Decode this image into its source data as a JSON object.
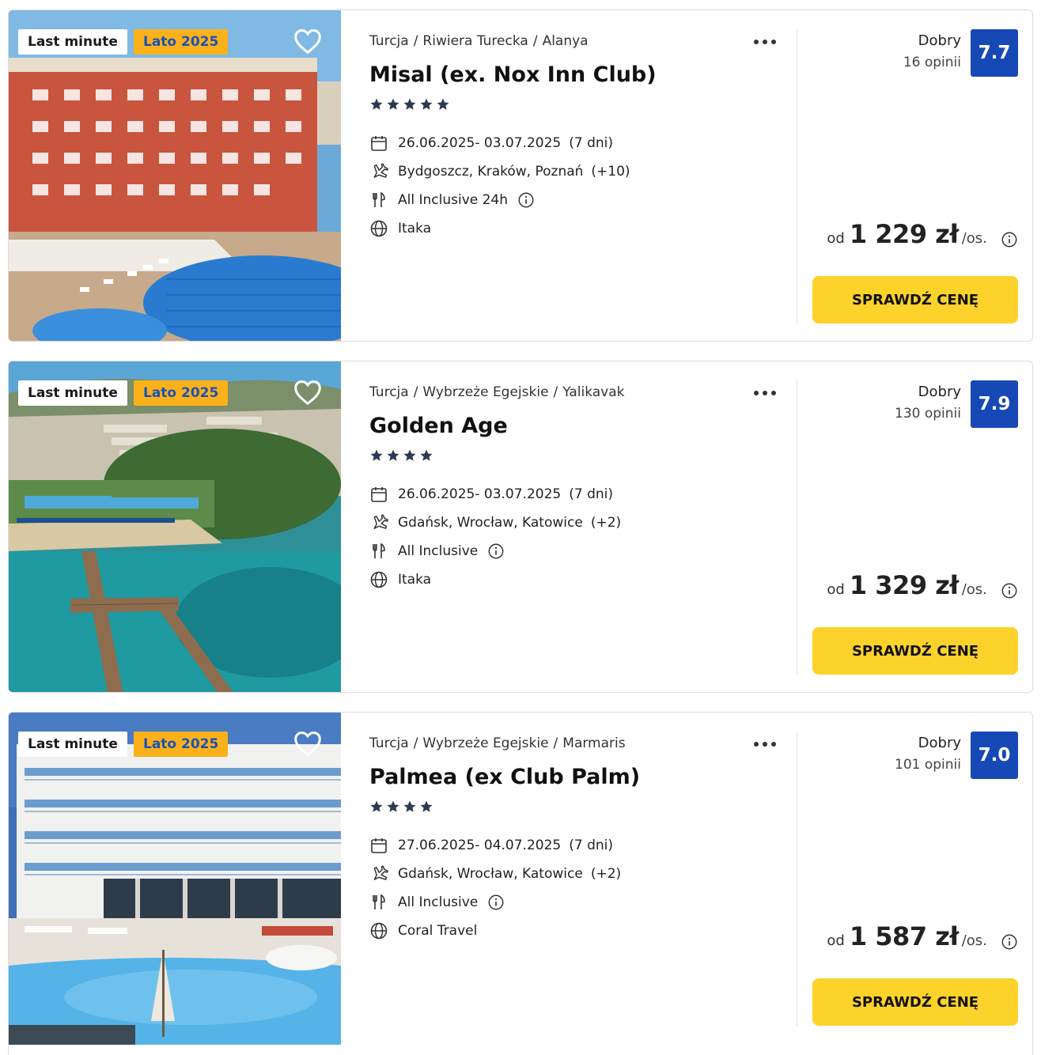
{
  "offers": [
    {
      "badge_last_minute": "Last minute",
      "badge_season": "Lato 2025",
      "breadcrumb": [
        "Turcja",
        "Riwiera Turecka",
        "Alanya"
      ],
      "name": "Misal (ex. Nox Inn Club)",
      "stars": 5,
      "dates": "26.06.2025- 03.07.2025",
      "duration": "(7 dni)",
      "departures": "Bydgoszcz, Kraków, Poznań",
      "departures_more": "(+10)",
      "board": "All Inclusive 24h",
      "operator": "Itaka",
      "rating_word": "Dobry",
      "rating_count": "16 opinii",
      "rating_score": "7.7",
      "price_prefix": "od",
      "price": "1 229 zł",
      "price_unit": "/os.",
      "cta": "SPRAWDŹ CENĘ",
      "image_theme": "hotel-red"
    },
    {
      "badge_last_minute": "Last minute",
      "badge_season": "Lato 2025",
      "breadcrumb": [
        "Turcja",
        "Wybrzeże Egejskie",
        "Yalikavak"
      ],
      "name": "Golden Age",
      "stars": 4,
      "dates": "26.06.2025- 03.07.2025",
      "duration": "(7 dni)",
      "departures": "Gdańsk, Wrocław, Katowice",
      "departures_more": "(+2)",
      "board": "All Inclusive",
      "operator": "Itaka",
      "rating_word": "Dobry",
      "rating_count": "130 opinii",
      "rating_score": "7.9",
      "price_prefix": "od",
      "price": "1 329 zł",
      "price_unit": "/os.",
      "cta": "SPRAWDŹ CENĘ",
      "image_theme": "bay-pier"
    },
    {
      "badge_last_minute": "Last minute",
      "badge_season": "Lato 2025",
      "breadcrumb": [
        "Turcja",
        "Wybrzeże Egejskie",
        "Marmaris"
      ],
      "name": "Palmea (ex Club Palm)",
      "stars": 4,
      "dates": "27.06.2025- 04.07.2025",
      "duration": "(7 dni)",
      "departures": "Gdańsk, Wrocław, Katowice",
      "departures_more": "(+2)",
      "board": "All Inclusive",
      "operator": "Coral Travel",
      "rating_word": "Dobry",
      "rating_count": "101 opinii",
      "rating_score": "7.0",
      "price_prefix": "od",
      "price": "1 587 zł",
      "price_unit": "/os.",
      "cta": "SPRAWDŹ CENĘ",
      "image_theme": "hotel-white"
    }
  ],
  "colors": {
    "rating_bg": "#1649b5",
    "cta_bg": "#fdd22a",
    "season_badge_bg": "#fbb11a",
    "season_badge_text": "#1a52b8",
    "star": "#2b3a55"
  },
  "icons": {
    "favorite": "heart-icon",
    "more": "more-dots-icon",
    "dates": "calendar-icon",
    "departures": "plane-icon",
    "board": "cutlery-icon",
    "operator": "globe-icon",
    "info": "info-icon",
    "star": "star-icon"
  }
}
